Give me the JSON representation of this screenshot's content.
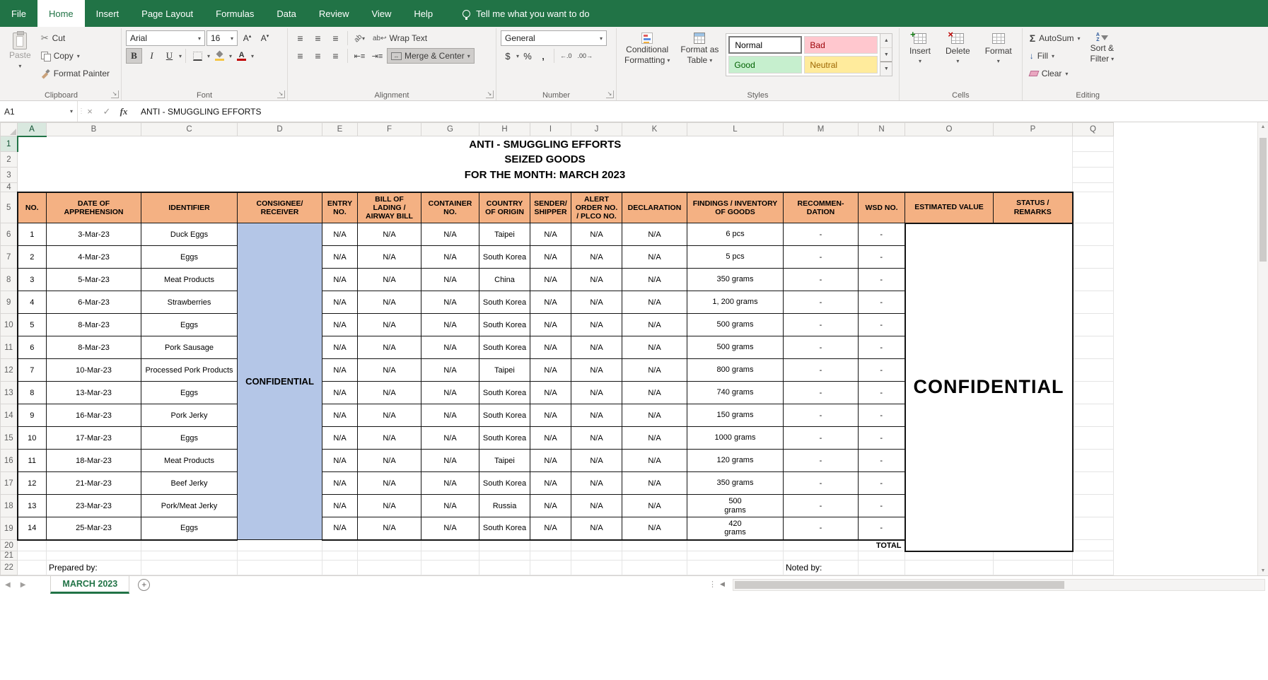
{
  "ribbon": {
    "tabs": [
      "File",
      "Home",
      "Insert",
      "Page Layout",
      "Formulas",
      "Data",
      "Review",
      "View",
      "Help"
    ],
    "active_tab": "Home",
    "tell_me": "Tell me what you want to do",
    "clipboard": {
      "label": "Clipboard",
      "paste": "Paste",
      "cut": "Cut",
      "copy": "Copy",
      "format_painter": "Format Painter"
    },
    "font": {
      "label": "Font",
      "family": "Arial",
      "size": "16",
      "bold": "B",
      "italic": "I",
      "underline": "U"
    },
    "alignment": {
      "label": "Alignment",
      "wrap_text": "Wrap Text",
      "merge_center": "Merge & Center"
    },
    "number": {
      "label": "Number",
      "format": "General",
      "currency": "$",
      "percent": "%",
      "comma": ","
    },
    "styles": {
      "label": "Styles",
      "conditional_line1": "Conditional",
      "conditional_line2": "Formatting",
      "format_table_line1": "Format as",
      "format_table_line2": "Table",
      "chips": [
        "Normal",
        "Bad",
        "Good",
        "Neutral"
      ]
    },
    "cells": {
      "label": "Cells",
      "insert": "Insert",
      "delete": "Delete",
      "format": "Format"
    },
    "editing": {
      "label": "Editing",
      "autosum": "AutoSum",
      "fill": "Fill",
      "clear": "Clear",
      "sort_line1": "Sort &",
      "sort_line2": "Filter"
    }
  },
  "formula_bar": {
    "name_box": "A1",
    "fx_label": "fx",
    "formula": "ANTI - SMUGGLING EFFORTS"
  },
  "grid": {
    "columns": [
      "A",
      "B",
      "C",
      "D",
      "E",
      "F",
      "G",
      "H",
      "I",
      "J",
      "K",
      "L",
      "M",
      "N",
      "O",
      "P",
      "Q"
    ],
    "row_numbers": [
      1,
      2,
      3,
      4,
      5,
      6,
      7,
      8,
      9,
      10,
      11,
      12,
      13,
      14,
      15,
      16,
      17,
      18,
      19,
      20,
      21,
      22
    ],
    "selected_column": "A",
    "selected_row": 1
  },
  "sheet": {
    "titles": [
      "ANTI - SMUGGLING EFFORTS",
      "SEIZED GOODS",
      "FOR THE MONTH: MARCH 2023"
    ],
    "headers": [
      "NO.",
      "DATE OF\nAPPREHENSION",
      "IDENTIFIER",
      "CONSIGNEE/\nRECEIVER",
      "ENTRY\nNO.",
      "BILL OF\nLADING /\nAIRWAY BILL",
      "CONTAINER\nNO.",
      "COUNTRY\nOF ORIGIN",
      "SENDER/\nSHIPPER",
      "ALERT\nORDER NO.\n/ PLCO NO.",
      "DECLARATION",
      "FINDINGS / INVENTORY\nOF GOODS",
      "RECOMMEN-\nDATION",
      "WSD NO.",
      "ESTIMATED VALUE",
      "STATUS /\nREMARKS"
    ],
    "consignee_confidential": "CONFIDENTIAL",
    "value_confidential": "CONFIDENTIAL",
    "rows": [
      [
        "1",
        "3-Mar-23",
        "Duck Eggs",
        "N/A",
        "N/A",
        "N/A",
        "Taipei",
        "N/A",
        "N/A",
        "N/A",
        "6 pcs",
        "-",
        "-"
      ],
      [
        "2",
        "4-Mar-23",
        "Eggs",
        "N/A",
        "N/A",
        "N/A",
        "South Korea",
        "N/A",
        "N/A",
        "N/A",
        "5 pcs",
        "-",
        "-"
      ],
      [
        "3",
        "5-Mar-23",
        "Meat Products",
        "N/A",
        "N/A",
        "N/A",
        "China",
        "N/A",
        "N/A",
        "N/A",
        "350 grams",
        "-",
        "-"
      ],
      [
        "4",
        "6-Mar-23",
        "Strawberries",
        "N/A",
        "N/A",
        "N/A",
        "South Korea",
        "N/A",
        "N/A",
        "N/A",
        "1, 200 grams",
        "-",
        "-"
      ],
      [
        "5",
        "8-Mar-23",
        "Eggs",
        "N/A",
        "N/A",
        "N/A",
        "South Korea",
        "N/A",
        "N/A",
        "N/A",
        "500 grams",
        "-",
        "-"
      ],
      [
        "6",
        "8-Mar-23",
        "Pork Sausage",
        "N/A",
        "N/A",
        "N/A",
        "South Korea",
        "N/A",
        "N/A",
        "N/A",
        "500 grams",
        "-",
        "-"
      ],
      [
        "7",
        "10-Mar-23",
        "Processed Pork Products",
        "N/A",
        "N/A",
        "N/A",
        "Taipei",
        "N/A",
        "N/A",
        "N/A",
        "800 grams",
        "-",
        "-"
      ],
      [
        "8",
        "13-Mar-23",
        "Eggs",
        "N/A",
        "N/A",
        "N/A",
        "South Korea",
        "N/A",
        "N/A",
        "N/A",
        "740 grams",
        "-",
        "-"
      ],
      [
        "9",
        "16-Mar-23",
        "Pork Jerky",
        "N/A",
        "N/A",
        "N/A",
        "South Korea",
        "N/A",
        "N/A",
        "N/A",
        "150 grams",
        "-",
        "-"
      ],
      [
        "10",
        "17-Mar-23",
        "Eggs",
        "N/A",
        "N/A",
        "N/A",
        "South Korea",
        "N/A",
        "N/A",
        "N/A",
        "1000 grams",
        "-",
        "-"
      ],
      [
        "11",
        "18-Mar-23",
        "Meat Products",
        "N/A",
        "N/A",
        "N/A",
        "Taipei",
        "N/A",
        "N/A",
        "N/A",
        "120 grams",
        "-",
        "-"
      ],
      [
        "12",
        "21-Mar-23",
        "Beef Jerky",
        "N/A",
        "N/A",
        "N/A",
        "South Korea",
        "N/A",
        "N/A",
        "N/A",
        "350 grams",
        "-",
        "-"
      ],
      [
        "13",
        "23-Mar-23",
        "Pork/Meat Jerky",
        "N/A",
        "N/A",
        "N/A",
        "Russia",
        "N/A",
        "N/A",
        "N/A",
        "500\ngrams",
        "-",
        "-"
      ],
      [
        "14",
        "25-Mar-23",
        "Eggs",
        "N/A",
        "N/A",
        "N/A",
        "South Korea",
        "N/A",
        "N/A",
        "N/A",
        "420\ngrams",
        "-",
        "-"
      ]
    ],
    "total_label": "TOTAL",
    "prepared_by": "Prepared by:",
    "noted_by": "Noted by:"
  },
  "sheet_tabs": {
    "active_tab": "MARCH 2023"
  },
  "colors": {
    "excel_green": "#217346",
    "table_header_fill": "#F4B183",
    "confidential_fill": "#B4C6E7",
    "style_bad_fill": "#FFC7CE",
    "style_bad_text": "#9C0006",
    "style_good_fill": "#C6EFCE",
    "style_good_text": "#006100",
    "style_neutral_fill": "#FFEB9C",
    "style_neutral_text": "#9C6500"
  },
  "icons": [
    "lightbulb-icon",
    "clipboard-paste-icon",
    "scissors-icon",
    "copy-icon",
    "format-painter-icon",
    "bold-icon",
    "italic-icon",
    "underline-icon",
    "increase-font-icon",
    "decrease-font-icon",
    "borders-icon",
    "fill-color-icon",
    "font-color-icon",
    "align-top-icon",
    "align-middle-icon",
    "align-bottom-icon",
    "orientation-icon",
    "wrap-text-icon",
    "align-left-icon",
    "align-center-icon",
    "align-right-icon",
    "decrease-indent-icon",
    "increase-indent-icon",
    "merge-center-icon",
    "currency-icon",
    "percent-icon",
    "comma-icon",
    "increase-decimal-icon",
    "decrease-decimal-icon",
    "conditional-formatting-icon",
    "format-as-table-icon",
    "insert-cells-icon",
    "delete-cells-icon",
    "format-cells-icon",
    "autosum-icon",
    "fill-down-icon",
    "eraser-icon",
    "sort-filter-icon",
    "name-box-dropdown-icon",
    "cancel-icon",
    "enter-icon",
    "insert-function-icon",
    "select-all-corner",
    "sheet-nav-left-icon",
    "sheet-nav-right-icon",
    "new-sheet-icon"
  ]
}
